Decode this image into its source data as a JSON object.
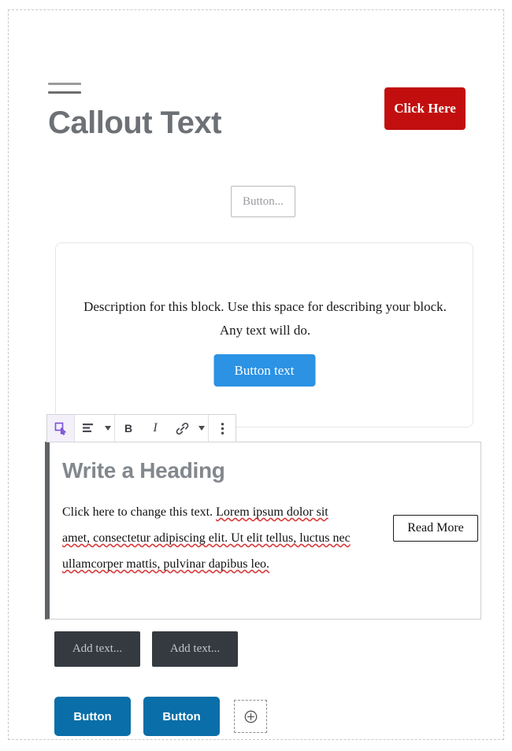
{
  "canvas": {
    "label": "page-canvas"
  },
  "header": {
    "menu_icon": "hamburger-icon",
    "title": "Callout Text",
    "cta_label": "Click Here",
    "cta_color": "#c20e0e"
  },
  "button_input": {
    "value": "",
    "placeholder": "Button..."
  },
  "description_block": {
    "text": "Description for this block. Use this space for describing your block. Any text will do.",
    "button_label": "Button text",
    "button_color": "#2b92e4"
  },
  "toolbar": {
    "items": [
      {
        "name": "block-type-icon",
        "label": "Select block",
        "active": true
      },
      {
        "name": "align-left-icon",
        "label": "Change alignment",
        "has_caret": true
      },
      {
        "name": "bold-icon",
        "label": "B"
      },
      {
        "name": "italic-icon",
        "label": "I"
      },
      {
        "name": "link-icon",
        "label": "Insert link",
        "has_caret": true
      },
      {
        "name": "more-options-icon",
        "label": "More options"
      }
    ],
    "active_color": "#6b3fd1"
  },
  "selected_block": {
    "heading": "Write a Heading",
    "body_prefix": "Click here to change this text. ",
    "body_misspelled": "Lorem ipsum dolor sit amet, consectetur adipiscing elit. Ut elit tellus, luctus nec ullamcorper mattis, pulvinar dapibus leo.",
    "read_more_label": "Read More",
    "selection_bar_color": "#5f6368"
  },
  "add_text_boxes": [
    {
      "value": "",
      "placeholder": "Add text..."
    },
    {
      "value": "",
      "placeholder": "Add text..."
    }
  ],
  "bottom_buttons": {
    "buttons": [
      {
        "label": "Button"
      },
      {
        "label": "Button"
      }
    ],
    "add_block_icon": "plus-circle-icon",
    "color": "#0a6ea8"
  }
}
